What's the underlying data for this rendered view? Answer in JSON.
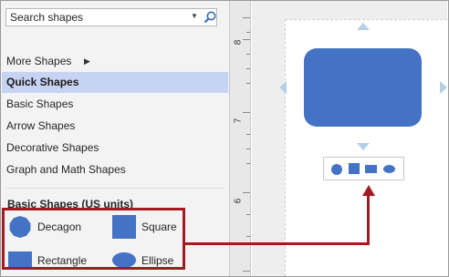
{
  "search": {
    "value": "Search shapes",
    "placeholder": "Search shapes"
  },
  "nav": {
    "more_shapes": "More Shapes",
    "quick_shapes": "Quick Shapes",
    "basic_shapes": "Basic Shapes",
    "arrow_shapes": "Arrow Shapes",
    "decorative_shapes": "Decorative Shapes",
    "graph_math_shapes": "Graph and Math Shapes"
  },
  "stencil": {
    "title": "Basic Shapes (US units)",
    "shapes": [
      {
        "label": "Decagon",
        "icon": "decagon-icon"
      },
      {
        "label": "Square",
        "icon": "square-icon"
      },
      {
        "label": "Rectangle",
        "icon": "rectangle-icon"
      },
      {
        "label": "Ellipse",
        "icon": "ellipse-icon"
      }
    ]
  },
  "ruler": {
    "labels": [
      "8",
      "7",
      "6"
    ]
  },
  "colors": {
    "shape_fill": "#4472c4",
    "selection": "#c6d3f2",
    "callout": "#a31b20",
    "connector_arrow": "#b4cfe6"
  }
}
